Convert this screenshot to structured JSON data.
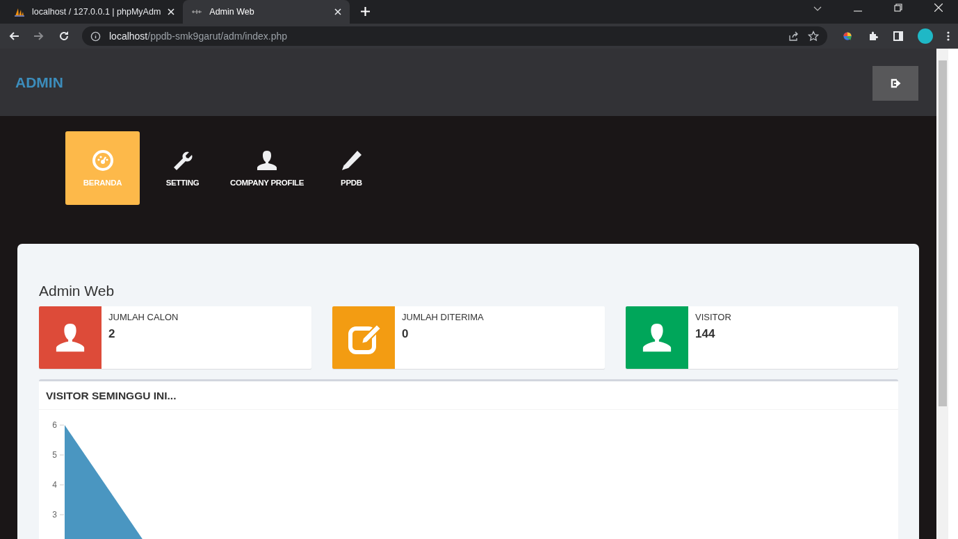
{
  "browser": {
    "tabs": [
      {
        "title": "localhost / 127.0.0.1 | phpMyAdm",
        "selected": false
      },
      {
        "title": "Admin Web",
        "selected": true
      }
    ],
    "url_host": "localhost",
    "url_path": "/ppdb-smk9garut/adm/index.php"
  },
  "header": {
    "title": "ADMIN"
  },
  "nav": [
    {
      "label": "BERANDA",
      "kind": "dashboard",
      "selected": true
    },
    {
      "label": "SETTING",
      "kind": "wrench",
      "selected": false
    },
    {
      "label": "COMPANY PROFILE",
      "kind": "user",
      "selected": false
    },
    {
      "label": "PPDB",
      "kind": "pencil",
      "selected": false
    }
  ],
  "page_title": "Admin Web",
  "stats": [
    {
      "label": "JUMLAH CALON",
      "value": "2",
      "kind": "user",
      "color": "#dd4b39"
    },
    {
      "label": "JUMLAH DITERIMA",
      "value": "0",
      "kind": "edit",
      "color": "#f39c12"
    },
    {
      "label": "VISITOR",
      "value": "144",
      "kind": "user",
      "color": "#00a65a"
    }
  ],
  "chart_panel": {
    "title": "VISITOR SEMINGGU INI...",
    "y_axis_labels": [
      "6",
      "5",
      "4",
      "3"
    ]
  }
}
